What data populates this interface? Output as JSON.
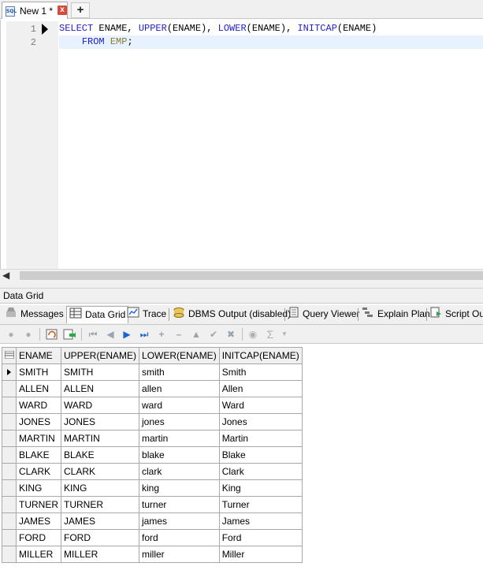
{
  "tab": {
    "label": "New 1 *",
    "icon": "sql-file-icon",
    "close": "x",
    "new_tab": "+"
  },
  "editor": {
    "line_numbers": [
      "1",
      "2"
    ],
    "line1": {
      "select": "SELECT",
      "ename1": " ENAME, ",
      "upper": "UPPER",
      "arg2": "(ENAME), ",
      "lower": "LOWER",
      "arg3": "(ENAME), ",
      "initcap": "INITCAP",
      "arg4": "(ENAME)"
    },
    "line2": {
      "indent": "    ",
      "from": "FROM",
      "space": " ",
      "table": "EMP",
      "semi": ";"
    }
  },
  "panel_caption": "Data Grid",
  "result_tabs": [
    {
      "label": "Messages",
      "icon": "messages-icon"
    },
    {
      "label": "Data Grid",
      "icon": "data-grid-icon",
      "active": true
    },
    {
      "label": "Trace",
      "icon": "trace-icon"
    },
    {
      "label": "DBMS Output (disabled)",
      "icon": "dbms-output-icon"
    },
    {
      "label": "Query Viewer",
      "icon": "query-viewer-icon"
    },
    {
      "label": "Explain Plan",
      "icon": "explain-plan-icon"
    },
    {
      "label": "Script Out",
      "icon": "script-output-icon"
    }
  ],
  "grid": {
    "columns": [
      "ENAME",
      "UPPER(ENAME)",
      "LOWER(ENAME)",
      "INITCAP(ENAME)"
    ],
    "rows": [
      [
        "SMITH",
        "SMITH",
        "smith",
        "Smith"
      ],
      [
        "ALLEN",
        "ALLEN",
        "allen",
        "Allen"
      ],
      [
        "WARD",
        "WARD",
        "ward",
        "Ward"
      ],
      [
        "JONES",
        "JONES",
        "jones",
        "Jones"
      ],
      [
        "MARTIN",
        "MARTIN",
        "martin",
        "Martin"
      ],
      [
        "BLAKE",
        "BLAKE",
        "blake",
        "Blake"
      ],
      [
        "CLARK",
        "CLARK",
        "clark",
        "Clark"
      ],
      [
        "KING",
        "KING",
        "king",
        "King"
      ],
      [
        "TURNER",
        "TURNER",
        "turner",
        "Turner"
      ],
      [
        "JAMES",
        "JAMES",
        "james",
        "James"
      ],
      [
        "FORD",
        "FORD",
        "ford",
        "Ford"
      ],
      [
        "MILLER",
        "MILLER",
        "miller",
        "Miller"
      ]
    ]
  },
  "colors": {
    "keyword": "#1e1ec8",
    "table_name": "#8a7a38",
    "active_line": "#e8f2fe"
  }
}
